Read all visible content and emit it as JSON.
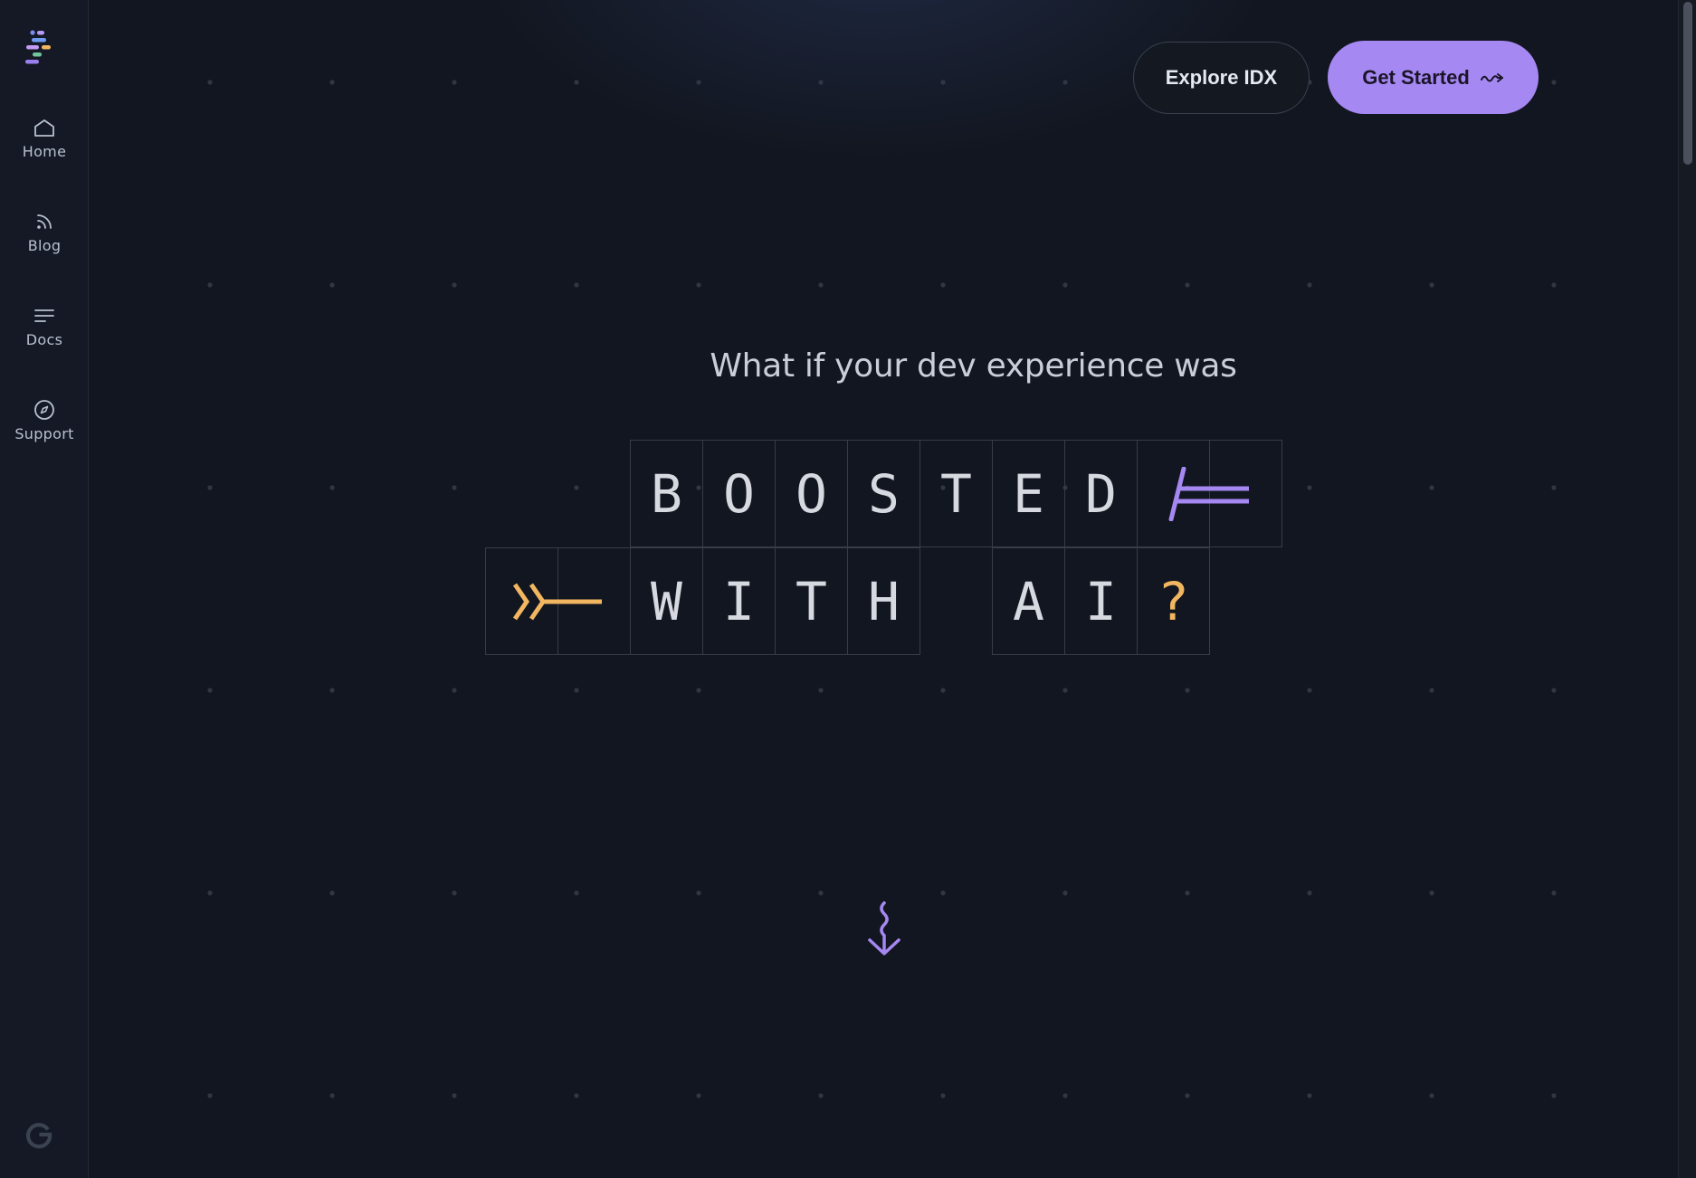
{
  "sidebar": {
    "logo_icon": "idx-logo-icon",
    "items": [
      {
        "label": "Home",
        "icon": "home-icon"
      },
      {
        "label": "Blog",
        "icon": "rss-icon"
      },
      {
        "label": "Docs",
        "icon": "docs-lines-icon"
      },
      {
        "label": "Support",
        "icon": "compass-icon"
      }
    ],
    "footer_icon": "google-g-icon"
  },
  "header": {
    "explore_label": "Explore IDX",
    "get_started_label": "Get Started",
    "get_started_icon": "squiggle-arrow-right-icon"
  },
  "hero": {
    "headline": "What if your dev experience was",
    "row1": [
      "B",
      "O",
      "O",
      "S",
      "T",
      "E",
      "D"
    ],
    "row2_word1": [
      "W",
      "I",
      "T",
      "H"
    ],
    "row2_word2": [
      "A",
      "I"
    ],
    "question_mark": "?",
    "decor_icons": [
      "purple-slash-lines-icon",
      "orange-chevron-arrow-icon"
    ],
    "scroll_hint_icon": "squiggle-arrow-down-icon"
  },
  "colors": {
    "accent_purple": "#a688f2",
    "accent_orange": "#f2b661",
    "background": "#121620",
    "sidebar_bg": "#141925"
  }
}
